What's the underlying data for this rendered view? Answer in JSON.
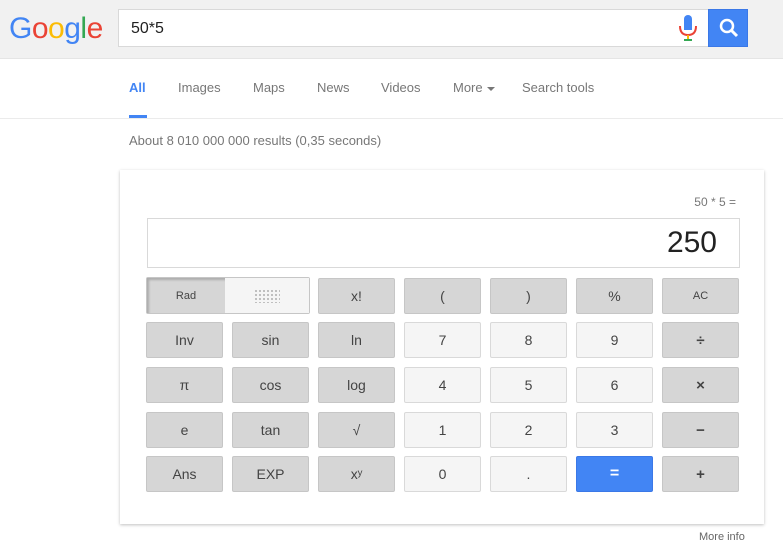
{
  "logo": {
    "letters": [
      {
        "ch": "G",
        "color": "#4285f4"
      },
      {
        "ch": "o",
        "color": "#ea4335"
      },
      {
        "ch": "o",
        "color": "#fbbc05"
      },
      {
        "ch": "g",
        "color": "#4285f4"
      },
      {
        "ch": "l",
        "color": "#34a853"
      },
      {
        "ch": "e",
        "color": "#ea4335"
      }
    ]
  },
  "search": {
    "query": "50*5",
    "mic_icon": "microphone-icon",
    "search_icon": "magnifier-icon"
  },
  "tabs": {
    "all": "All",
    "images": "Images",
    "maps": "Maps",
    "news": "News",
    "videos": "Videos",
    "more": "More",
    "tools": "Search tools"
  },
  "stats": "About 8 010 000 000 results (0,35 seconds)",
  "calculator": {
    "history": "50 * 5 =",
    "display": "250",
    "rad": "Rad",
    "keys": {
      "fact": "x!",
      "lparen": "(",
      "rparen": ")",
      "percent": "%",
      "ac": "AC",
      "inv": "Inv",
      "sin": "sin",
      "ln": "ln",
      "k7": "7",
      "k8": "8",
      "k9": "9",
      "div": "÷",
      "pi": "π",
      "cos": "cos",
      "log": "log",
      "k4": "4",
      "k5": "5",
      "k6": "6",
      "mul": "×",
      "e": "e",
      "tan": "tan",
      "sqrt": "√",
      "k1": "1",
      "k2": "2",
      "k3": "3",
      "minus": "−",
      "ans": "Ans",
      "exp": "EXP",
      "pow": "xʸ",
      "k0": "0",
      "dot": ".",
      "eq": "=",
      "plus": "+"
    }
  },
  "more_info": "More info",
  "colors": {
    "accent": "#4285f4",
    "header_bg": "#f1f1f1"
  }
}
